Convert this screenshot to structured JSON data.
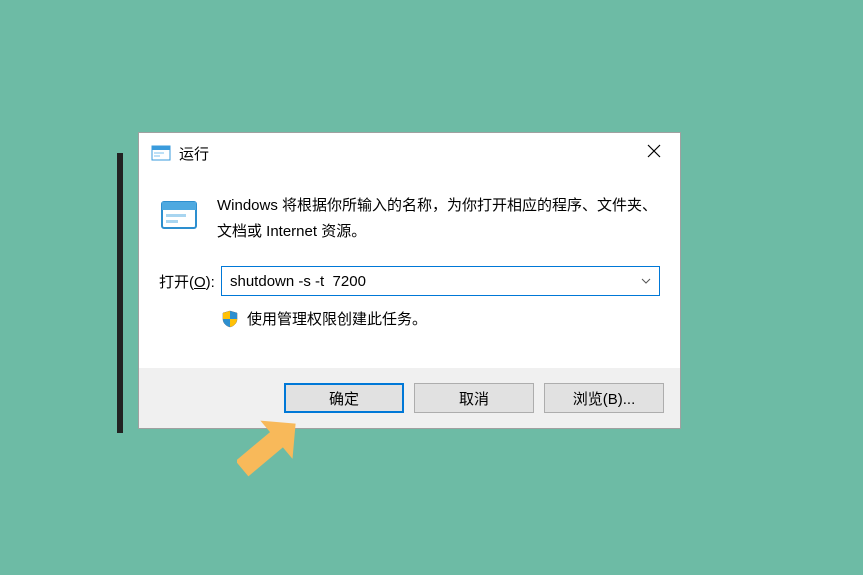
{
  "dialog": {
    "title": "运行",
    "description": "Windows 将根据你所输入的名称，为你打开相应的程序、文件夹、文档或 Internet 资源。",
    "open_label_prefix": "打开(",
    "open_label_key": "O",
    "open_label_suffix": "):",
    "input_value": "shutdown -s -t  7200",
    "admin_text": "使用管理权限创建此任务。",
    "buttons": {
      "ok": "确定",
      "cancel": "取消",
      "browse": "浏览(B)..."
    }
  }
}
